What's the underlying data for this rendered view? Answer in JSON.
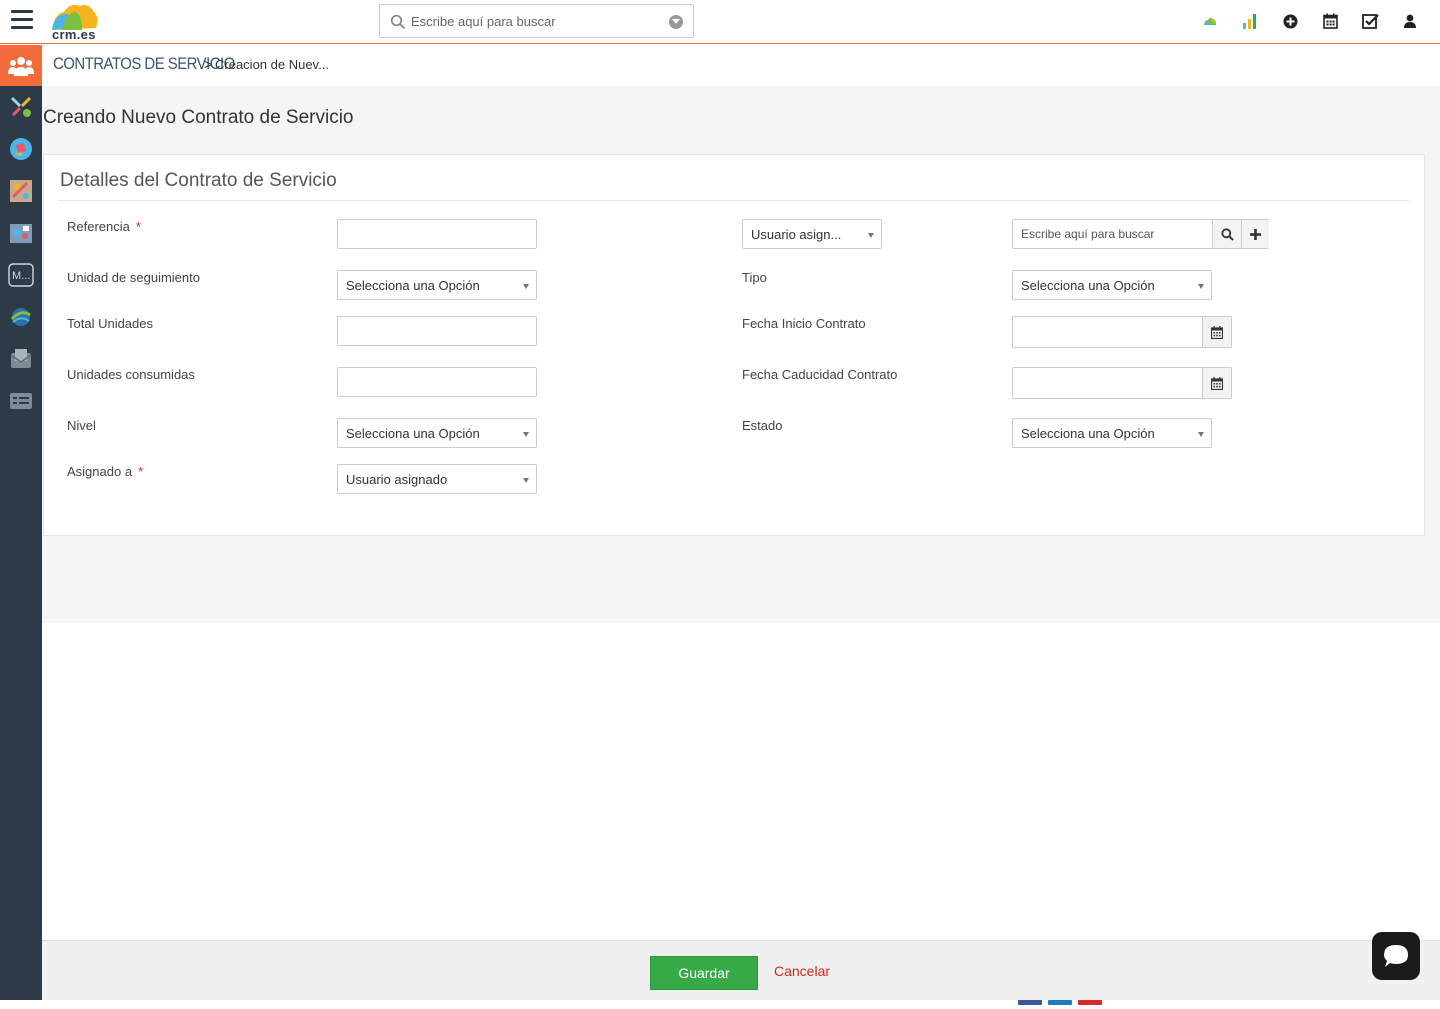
{
  "app": {
    "logo_text": "crm.es"
  },
  "topbar": {
    "search_placeholder": "Escribe aquí para buscar",
    "icons": [
      "cloud-icon",
      "bar-chart-icon",
      "add-circle-icon",
      "calendar-icon",
      "checkbox-icon",
      "user-icon"
    ]
  },
  "breadcrumb": {
    "module": "CONTRATOS DE SERVICIO",
    "separator": ">",
    "current": "Creacion de Nuev..."
  },
  "page": {
    "title": "Creando Nuevo Contrato de Servicio"
  },
  "panel": {
    "title": "Detalles del Contrato de Servicio",
    "fields": {
      "referencia": {
        "label": "Referencia",
        "required": "*",
        "value": ""
      },
      "owner_select": {
        "value": "Usuario asign..."
      },
      "related_search": {
        "placeholder": "Escribe aquí para buscar"
      },
      "unidad_seguimiento": {
        "label": "Unidad de seguimiento",
        "value": "Selecciona una Opción"
      },
      "tipo": {
        "label": "Tipo",
        "value": "Selecciona una Opción"
      },
      "total_unidades": {
        "label": "Total Unidades",
        "value": ""
      },
      "fecha_inicio": {
        "label": "Fecha Inicio Contrato",
        "value": ""
      },
      "unidades_consumidas": {
        "label": "Unidades consumidas",
        "value": ""
      },
      "fecha_caducidad": {
        "label": "Fecha Caducidad Contrato",
        "value": ""
      },
      "nivel": {
        "label": "Nivel",
        "value": "Selecciona una Opción"
      },
      "estado": {
        "label": "Estado",
        "value": "Selecciona una Opción"
      },
      "asignado_a": {
        "label": "Asignado a",
        "required": "*",
        "value": "Usuario asignado"
      }
    }
  },
  "footer": {
    "save_label": "Guardar",
    "cancel_label": "Cancelar"
  },
  "colors": {
    "accent": "#f26b3a",
    "sidebar": "#2d3b48",
    "save": "#35aa47",
    "cancel": "#d0281e",
    "module": "#3c5670"
  }
}
